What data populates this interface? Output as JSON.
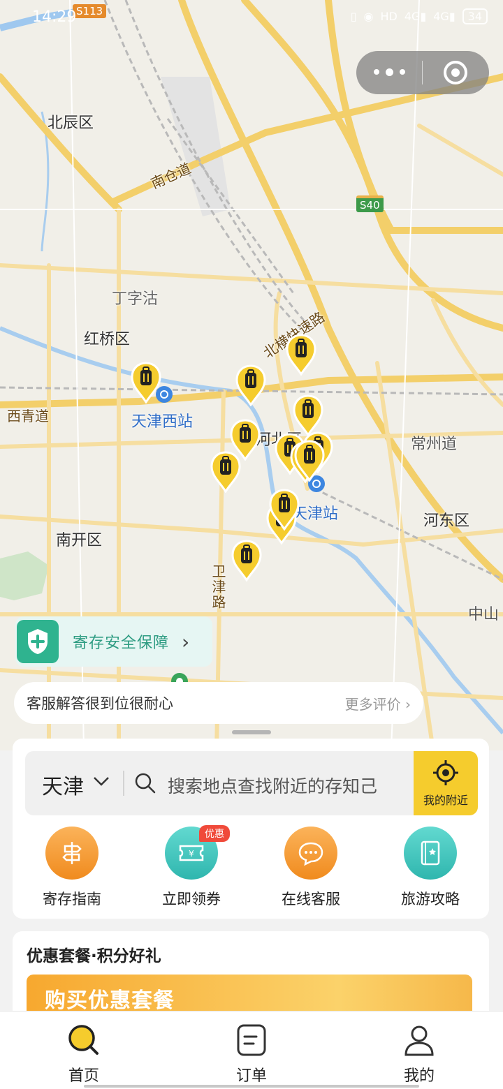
{
  "status_bar": {
    "time": "14:29",
    "carrier_icons": [
      "vibrate-icon",
      "location-icon",
      "hd-icon",
      "signal-4g-icon",
      "signal-4g-icon"
    ],
    "battery": "34"
  },
  "map": {
    "district_labels": [
      "北辰区",
      "红桥区",
      "南开区",
      "河东区",
      "河北区"
    ],
    "place_labels": [
      "丁字沽",
      "常州道",
      "中山"
    ],
    "road_labels": [
      "南仓道",
      "北横快速路",
      "西青道",
      "卫津路"
    ],
    "station_labels": [
      "天津西站",
      "天津站"
    ],
    "shields": [
      "S113",
      "S40"
    ],
    "pin_count": 13
  },
  "guarantee": {
    "label": "寄存安全保障"
  },
  "review": {
    "text": "客服解答很到位很耐心",
    "more": "更多评价"
  },
  "search": {
    "city": "天津",
    "placeholder": "搜索地点查找附近的存知己",
    "nearby_label": "我的附近"
  },
  "quick_actions": [
    {
      "label": "寄存指南",
      "icon": "signpost-icon"
    },
    {
      "label": "立即领券",
      "icon": "coupon-icon",
      "badge": "优惠"
    },
    {
      "label": "在线客服",
      "icon": "chat-icon"
    },
    {
      "label": "旅游攻略",
      "icon": "guidebook-icon"
    }
  ],
  "promo": {
    "title": "优惠套餐·积分好礼",
    "banner_text": "购买优惠套餐"
  },
  "tabs": [
    {
      "label": "首页",
      "icon": "search-icon"
    },
    {
      "label": "订单",
      "icon": "order-icon"
    },
    {
      "label": "我的",
      "icon": "user-icon"
    }
  ],
  "colors": {
    "accent": "#f5cc2d",
    "teal": "#2fb38f",
    "badge": "#f04a3a"
  }
}
